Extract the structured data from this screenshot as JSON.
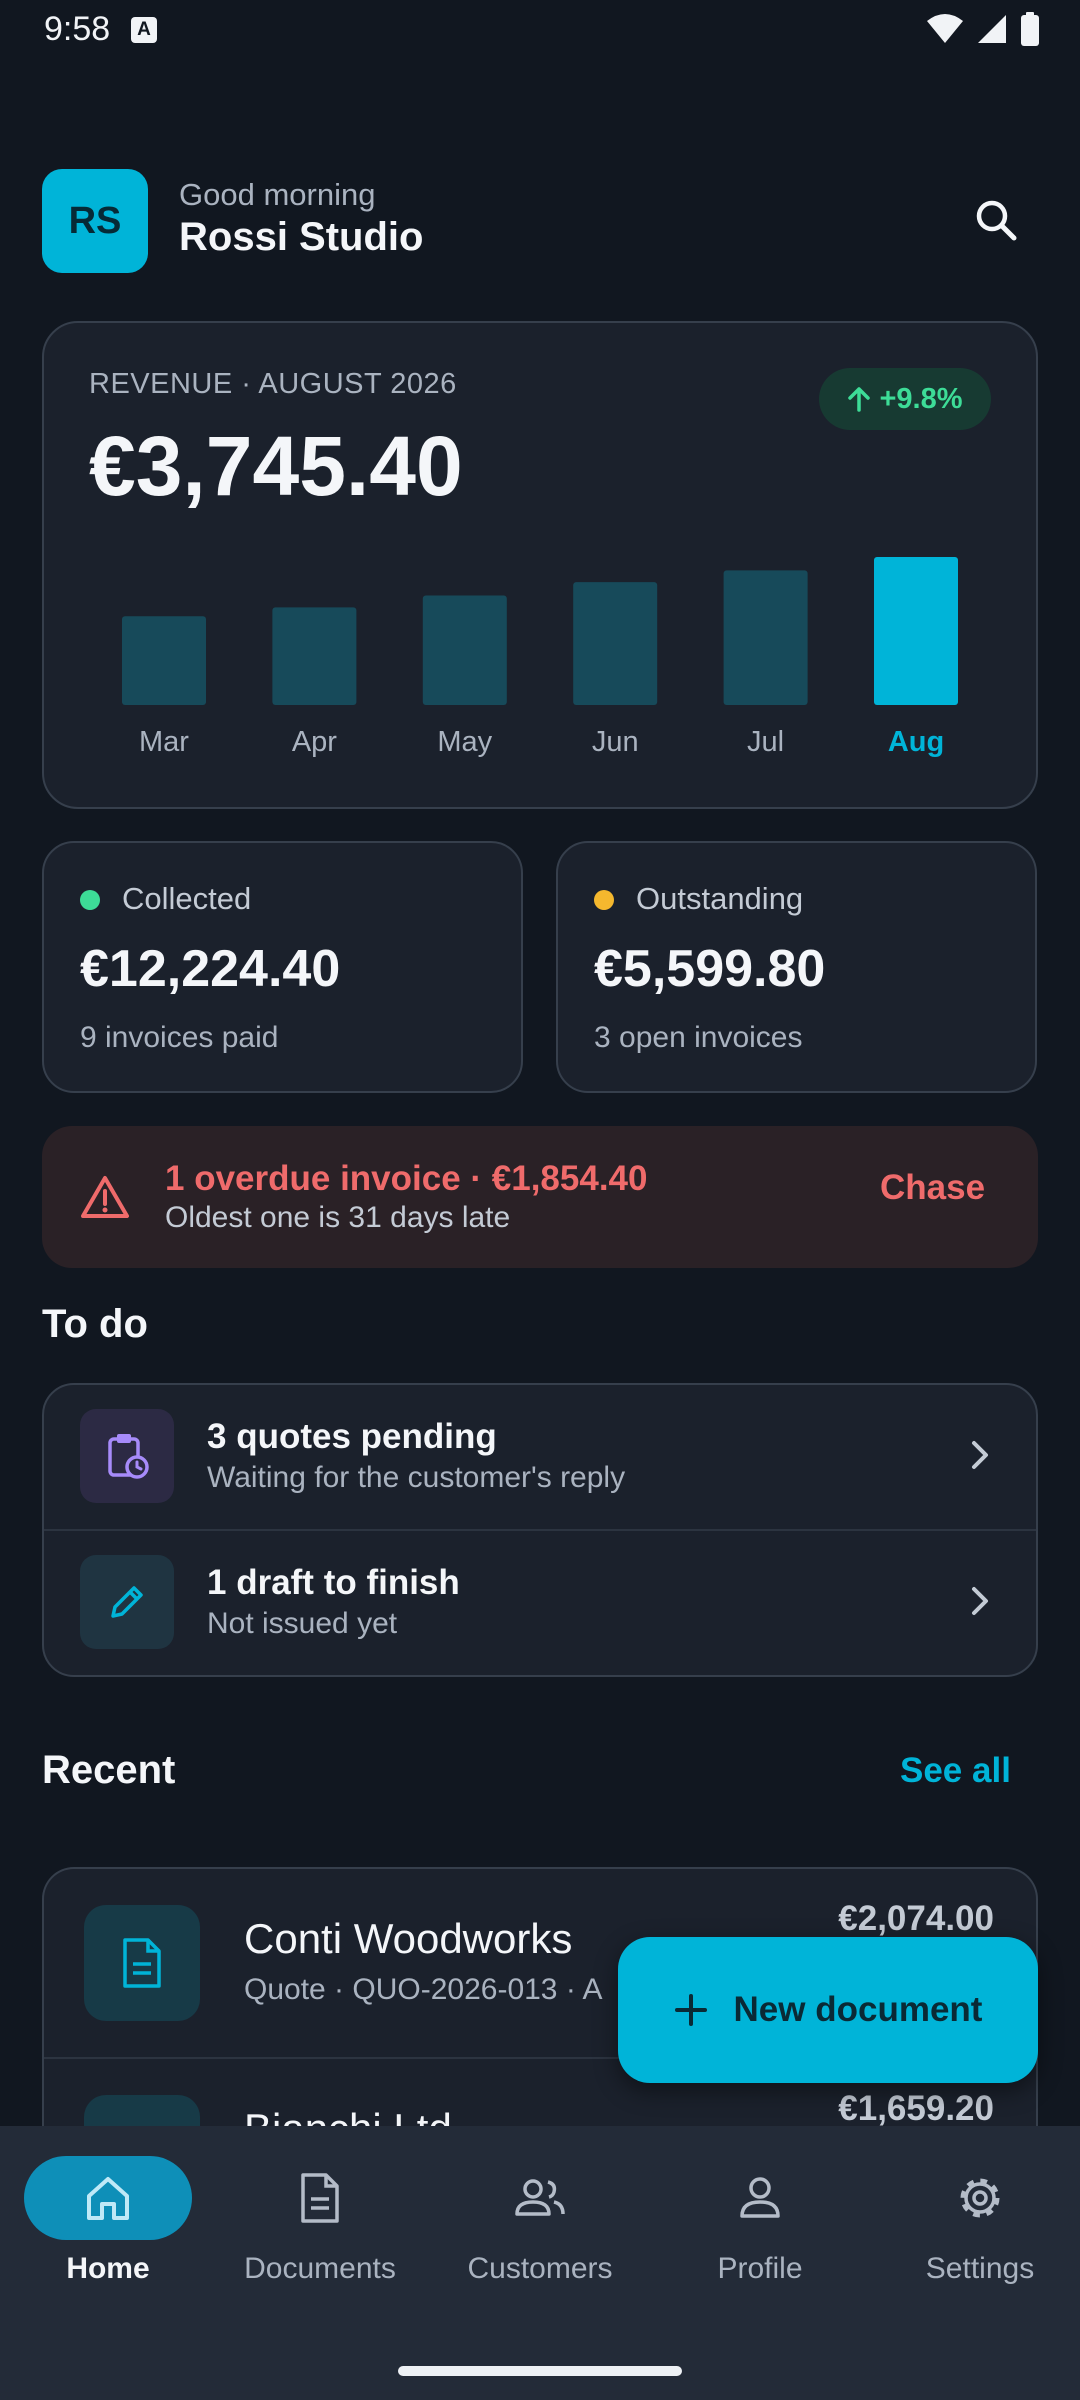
{
  "status_bar": {
    "time": "9:58",
    "notification_badge": "A"
  },
  "header": {
    "avatar_initials": "RS",
    "greeting": "Good morning",
    "name": "Rossi Studio"
  },
  "revenue": {
    "label": "REVENUE · AUGUST 2026",
    "amount": "€3,745.40",
    "change": "+9.8%",
    "accent": "#00b4d8",
    "muted_bar": "#174a5a"
  },
  "chart_data": {
    "type": "bar",
    "categories": [
      "Mar",
      "Apr",
      "May",
      "Jun",
      "Jul",
      "Aug"
    ],
    "values": [
      0.6,
      0.66,
      0.74,
      0.83,
      0.91,
      1.0
    ],
    "highlight": "Aug"
  },
  "stats": {
    "collected": {
      "label": "Collected",
      "amount": "€12,224.40",
      "sub": "9 invoices paid",
      "color": "#3ddc97"
    },
    "outstanding": {
      "label": "Outstanding",
      "amount": "€5,599.80",
      "sub": "3 open invoices",
      "color": "#f5b82e"
    }
  },
  "overdue": {
    "title": "1 overdue invoice · €1,854.40",
    "subtitle": "Oldest one is 31 days late",
    "action": "Chase",
    "color": "#ef6b6b"
  },
  "todo": {
    "title": "To do",
    "items": [
      {
        "title": "3 quotes pending",
        "subtitle": "Waiting for the customer's reply",
        "icon": "clipboard-clock-icon"
      },
      {
        "title": "1 draft to finish",
        "subtitle": "Not issued yet",
        "icon": "pencil-icon"
      }
    ]
  },
  "recent": {
    "title": "Recent",
    "see_all": "See all",
    "items": [
      {
        "name": "Conti Woodworks",
        "subtitle": "Quote · QUO-2026-013 · A",
        "amount": "€2,074.00",
        "icon": "document-icon"
      },
      {
        "name": "Bianchi Ltd",
        "subtitle": "",
        "amount": "€1,659.20",
        "icon": "document-icon"
      }
    ]
  },
  "fab": {
    "label": "New document"
  },
  "bottom_nav": {
    "items": [
      {
        "label": "Home",
        "icon": "home-icon",
        "active": true
      },
      {
        "label": "Documents",
        "icon": "documents-icon",
        "active": false
      },
      {
        "label": "Customers",
        "icon": "customers-icon",
        "active": false
      },
      {
        "label": "Profile",
        "icon": "profile-icon",
        "active": false
      },
      {
        "label": "Settings",
        "icon": "settings-icon",
        "active": false
      }
    ]
  }
}
